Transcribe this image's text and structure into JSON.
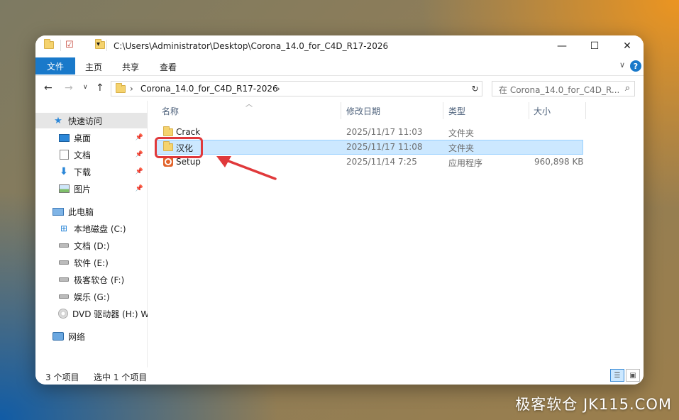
{
  "window": {
    "title": "C:\\Users\\Administrator\\Desktop\\Corona_14.0_for_C4D_R17-2026",
    "controls": {
      "minimize": "—",
      "maximize": "☐",
      "close": "✕"
    }
  },
  "ribbon": {
    "file": "文件",
    "tabs": [
      "主页",
      "共享",
      "查看"
    ],
    "help": "?"
  },
  "address": {
    "segment": "Corona_14.0_for_C4D_R17-2026",
    "search_placeholder": "在 Corona_14.0_for_C4D_R..."
  },
  "sidebar": {
    "quick_access": "快速访问",
    "quick_items": [
      "桌面",
      "文档",
      "下载",
      "图片"
    ],
    "this_pc": "此电脑",
    "drives": [
      "本地磁盘 (C:)",
      "文档 (D:)",
      "软件 (E:)",
      "极客软仓 (F:)",
      "娱乐 (G:)",
      "DVD 驱动器 (H:) W"
    ],
    "network": "网络"
  },
  "columns": {
    "name": "名称",
    "date": "修改日期",
    "type": "类型",
    "size": "大小"
  },
  "files": [
    {
      "name": "Crack",
      "date": "2025/11/17 11:03",
      "type": "文件夹",
      "size": "",
      "icon": "folder-icon"
    },
    {
      "name": "汉化",
      "date": "2025/11/17 11:08",
      "type": "文件夹",
      "size": "",
      "icon": "folder-icon",
      "selected": true
    },
    {
      "name": "Setup",
      "date": "2025/11/14 7:25",
      "type": "应用程序",
      "size": "960,898 KB",
      "icon": "setup-app-icon"
    }
  ],
  "status": {
    "count": "3 个项目",
    "selected": "选中 1 个项目"
  },
  "watermark": "极客软仓 JK115.COM",
  "colors": {
    "accent": "#1979ca",
    "selection": "#cce8ff",
    "highlight": "#e0393b"
  }
}
